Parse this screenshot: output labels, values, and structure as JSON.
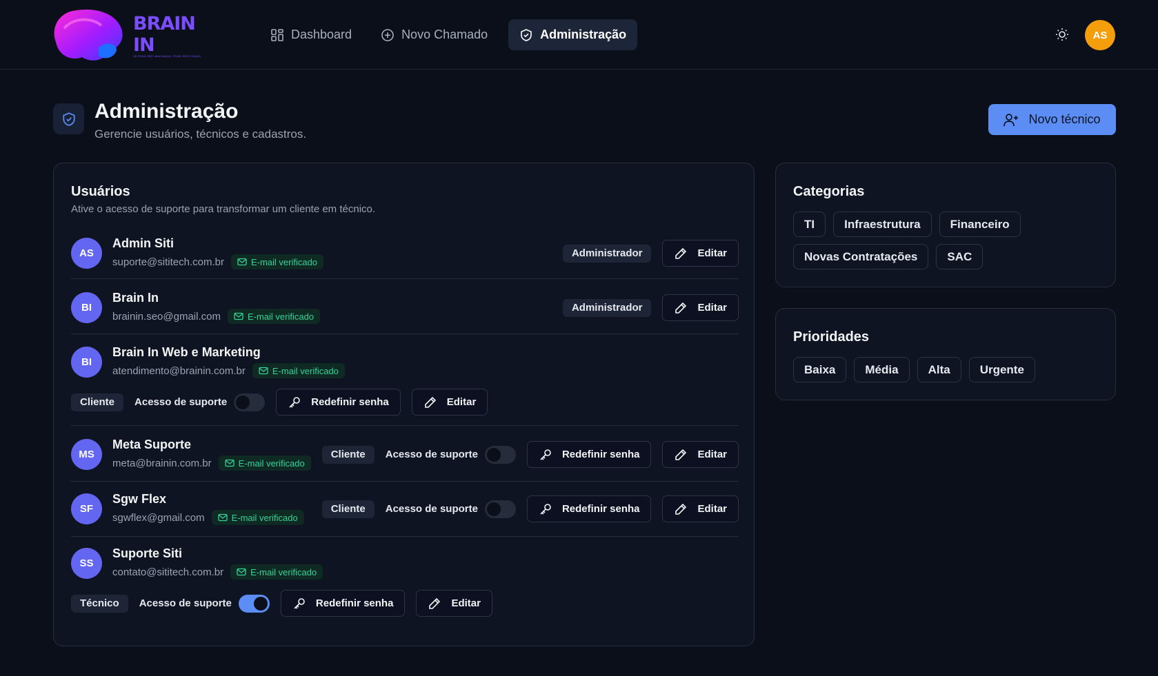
{
  "brand": {
    "name": "BRAIN IN",
    "tagline": "SE PODE SER IMAGINADO, PODE SER CRIADO."
  },
  "nav": [
    {
      "label": "Dashboard",
      "icon": "grid-icon"
    },
    {
      "label": "Novo Chamado",
      "icon": "plus-circle-icon"
    },
    {
      "label": "Administração",
      "icon": "shield-icon",
      "active": true
    }
  ],
  "header": {
    "avatar_initials": "AS",
    "theme_icon": "sun-icon"
  },
  "page": {
    "title": "Administração",
    "subtitle": "Gerencie usuários, técnicos e cadastros.",
    "new_tech_label": "Novo técnico"
  },
  "users": {
    "title": "Usuários",
    "subtitle": "Ative o acesso de suporte para transformar um cliente em técnico.",
    "verified_label": "E-mail verificado",
    "support_access_label": "Acesso de suporte",
    "reset_label": "Redefinir senha",
    "edit_label": "Editar",
    "list": [
      {
        "initials": "AS",
        "name": "Admin Siti",
        "email": "suporte@sititech.com.br",
        "role": "Administrador",
        "support_access": null
      },
      {
        "initials": "BI",
        "name": "Brain In",
        "email": "brainin.seo@gmail.com",
        "role": "Administrador",
        "support_access": null
      },
      {
        "initials": "BI",
        "name": "Brain In Web e Marketing",
        "email": "atendimento@brainin.com.br",
        "role": "Cliente",
        "support_access": false
      },
      {
        "initials": "MS",
        "name": "Meta Suporte",
        "email": "meta@brainin.com.br",
        "role": "Cliente",
        "support_access": false
      },
      {
        "initials": "SF",
        "name": "Sgw Flex",
        "email": "sgwflex@gmail.com",
        "role": "Cliente",
        "support_access": false
      },
      {
        "initials": "SS",
        "name": "Suporte Siti",
        "email": "contato@sititech.com.br",
        "role": "Técnico",
        "support_access": true
      }
    ]
  },
  "categories": {
    "title": "Categorias",
    "items": [
      "TI",
      "Infraestrutura",
      "Financeiro",
      "Novas Contratações",
      "SAC"
    ]
  },
  "priorities": {
    "title": "Prioridades",
    "items": [
      "Baixa",
      "Média",
      "Alta",
      "Urgente"
    ]
  },
  "colors": {
    "accent": "#5b8df5",
    "avatar": "#6366f1",
    "verified": "#34d399",
    "user_avatar": "#f59e0b"
  }
}
